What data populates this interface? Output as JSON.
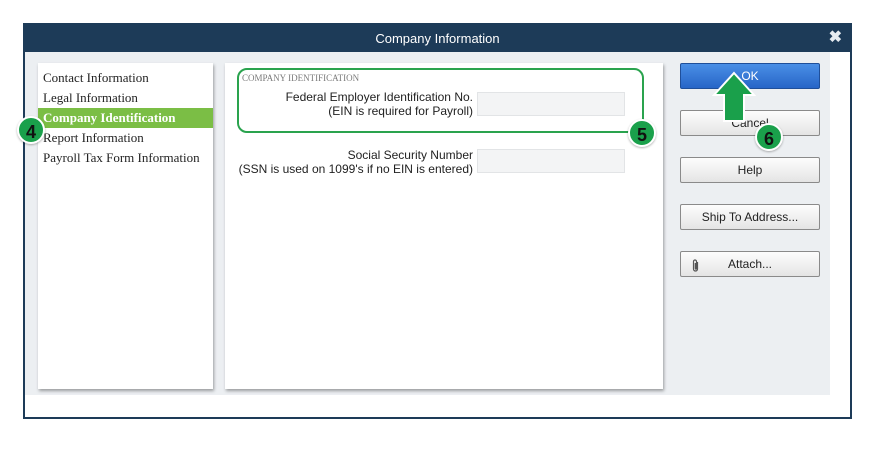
{
  "window": {
    "title": "Company Information",
    "close_glyph": "✖"
  },
  "nav": {
    "items": [
      {
        "label": "Contact Information"
      },
      {
        "label": "Legal Information"
      },
      {
        "label": "Company Identification",
        "selected": true
      },
      {
        "label": "Report Information"
      },
      {
        "label": "Payroll Tax Form Information"
      }
    ]
  },
  "section": {
    "title": "COMPANY IDENTIFICATION",
    "ein_label_line1": "Federal Employer Identification No.",
    "ein_label_line2": "(EIN is required for Payroll)",
    "ein_value": "",
    "ssn_label_line1": "Social Security Number",
    "ssn_label_line2": "(SSN is used on 1099's if no EIN is entered)",
    "ssn_value": ""
  },
  "buttons": {
    "ok": "OK",
    "cancel": "Cancel",
    "help": "Help",
    "ship_to": "Ship To Address...",
    "attach": "Attach..."
  },
  "annotations": {
    "step4": "4",
    "step5": "5",
    "step6": "6"
  },
  "colors": {
    "titlebar": "#1d3b58",
    "selected_nav": "#7bbe45",
    "annotation_green": "#1aa04b",
    "ok_button": "#2f72d6"
  },
  "icons": {
    "close": "close-icon",
    "attach": "paperclip-icon",
    "arrow": "up-arrow-icon"
  }
}
